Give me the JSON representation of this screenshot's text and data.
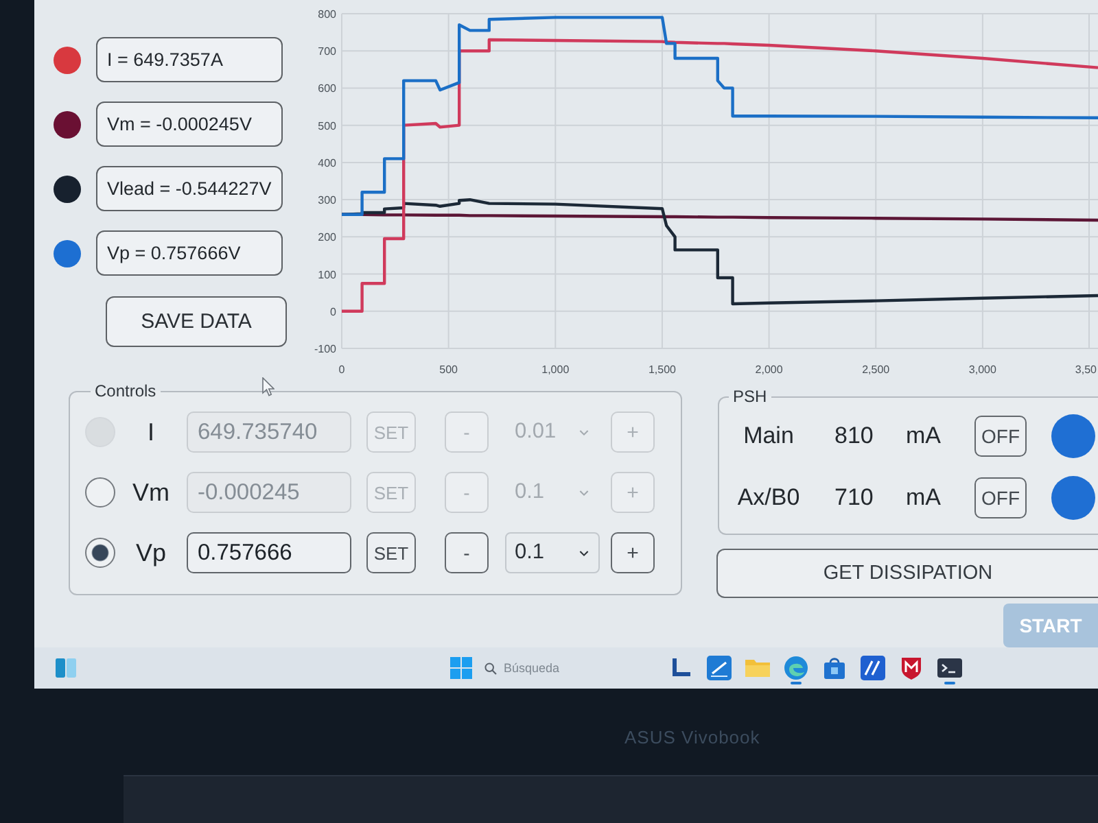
{
  "readouts": [
    {
      "text": "I = 649.7357A",
      "color": "#d8393f"
    },
    {
      "text": "Vm = -0.000245V",
      "color": "#6a1033"
    },
    {
      "text": "Vlead = -0.544227V",
      "color": "#17212e"
    },
    {
      "text": "Vp = 0.757666V",
      "color": "#1d6fd2"
    }
  ],
  "save_button": "SAVE DATA",
  "chart": {
    "chart_data": {
      "type": "line",
      "x": [
        0,
        95,
        95,
        200,
        200,
        290,
        290,
        440,
        460,
        550,
        550,
        600,
        690,
        690,
        1000,
        1500,
        1520,
        1560,
        1560,
        1760,
        1760,
        1790,
        1830,
        1830,
        2000,
        2500,
        3000,
        3540
      ],
      "series": [
        {
          "color": "#5c1636",
          "values": [
            260,
            260,
            260,
            259,
            259,
            259,
            259,
            258,
            258,
            258,
            258,
            257,
            257,
            257,
            256,
            254,
            254,
            254,
            254,
            253,
            253,
            253,
            253,
            253,
            252,
            250,
            248,
            245
          ]
        },
        {
          "color": "#1c2937",
          "values": [
            260,
            262,
            265,
            265,
            275,
            278,
            290,
            285,
            282,
            290,
            298,
            300,
            290,
            290,
            288,
            276,
            230,
            200,
            165,
            165,
            90,
            90,
            90,
            20,
            22,
            28,
            35,
            42
          ]
        },
        {
          "color": "#d03a5c",
          "values": [
            0,
            0,
            75,
            75,
            195,
            195,
            500,
            505,
            495,
            500,
            700,
            700,
            700,
            730,
            728,
            725,
            724,
            723,
            723,
            720,
            720,
            720,
            719,
            719,
            715,
            700,
            680,
            655
          ]
        },
        {
          "color": "#1b6fc6",
          "values": [
            260,
            260,
            320,
            320,
            410,
            410,
            620,
            620,
            595,
            615,
            770,
            755,
            755,
            785,
            790,
            790,
            720,
            720,
            680,
            680,
            620,
            600,
            600,
            525,
            525,
            524,
            522,
            520
          ]
        }
      ],
      "xlim": [
        0,
        3540
      ],
      "ylim": [
        -100,
        800
      ],
      "xticks": [
        0,
        500,
        {
          "value": 1000,
          "label": "1,000"
        },
        {
          "value": 1500,
          "label": "1,500"
        },
        {
          "value": 2000,
          "label": "2,000"
        },
        {
          "value": 2500,
          "label": "2,500"
        },
        {
          "value": 3000,
          "label": "3,000"
        }
      ],
      "yticks": [
        -100,
        0,
        100,
        200,
        300,
        400,
        500,
        600,
        700,
        800
      ],
      "grid": true
    },
    "cut_tick_label": "3,50"
  },
  "controls": {
    "title": "Controls",
    "rows": [
      {
        "label": "I",
        "value": "649.735740",
        "set": "SET",
        "minus": "-",
        "step": "0.01",
        "plus": "+",
        "selected": false,
        "radio_disabled": true,
        "disabled": true
      },
      {
        "label": "Vm",
        "value": "-0.000245",
        "set": "SET",
        "minus": "-",
        "step": "0.1",
        "plus": "+",
        "selected": false,
        "radio_disabled": false,
        "disabled": true
      },
      {
        "label": "Vp",
        "value": "0.757666",
        "set": "SET",
        "minus": "-",
        "step": "0.1",
        "plus": "+",
        "selected": true,
        "radio_disabled": false,
        "disabled": false
      }
    ]
  },
  "psh": {
    "title": "PSH",
    "rows": [
      {
        "name": "Main",
        "value": "810",
        "unit": "mA",
        "button": "OFF"
      },
      {
        "name": "Ax/B0",
        "value": "710",
        "unit": "mA",
        "button": "OFF"
      }
    ]
  },
  "dissipation_button": "GET DISSIPATION",
  "start_button": {
    "label": "START",
    "disabled": true
  },
  "taskbar": {
    "search_placeholder": "Búsqueda",
    "apps": [
      {
        "kind": "bracket",
        "running": false
      },
      {
        "kind": "pen",
        "running": false
      },
      {
        "kind": "folder",
        "running": false
      },
      {
        "kind": "browser",
        "running": true
      },
      {
        "kind": "store",
        "running": false
      },
      {
        "kind": "slash",
        "running": false
      },
      {
        "kind": "shield",
        "running": false
      },
      {
        "kind": "terminal",
        "running": true
      }
    ]
  },
  "laptop": {
    "bezel_label": "ASUS Vivobook"
  }
}
